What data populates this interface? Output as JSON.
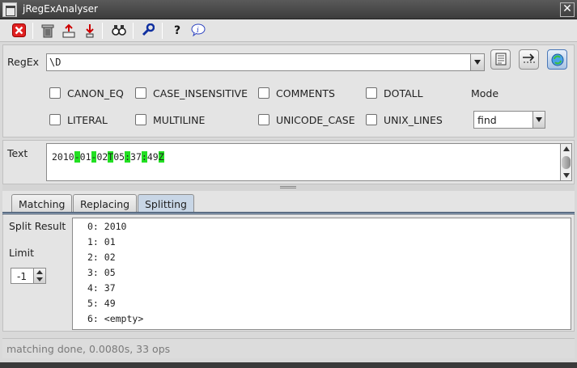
{
  "window": {
    "title": "jRegExAnalyser"
  },
  "toolbar": {
    "icons": [
      "close-red-x-icon",
      "trash-can-icon",
      "export-icon",
      "import-icon",
      "binoculars-icon",
      "wrench-icon",
      "help-question-icon",
      "info-icon"
    ]
  },
  "regex": {
    "label": "RegEx",
    "value": "\\D"
  },
  "flags": {
    "row1": [
      "CANON_EQ",
      "CASE_INSENSITIVE",
      "COMMENTS",
      "DOTALL"
    ],
    "row2": [
      "LITERAL",
      "MULTILINE",
      "UNICODE_CASE",
      "UNIX_LINES"
    ],
    "checked": []
  },
  "mode": {
    "label": "Mode",
    "value": "find"
  },
  "text": {
    "label": "Text",
    "segments": [
      {
        "t": "2010",
        "hl": false
      },
      {
        "t": "-",
        "hl": true
      },
      {
        "t": "01",
        "hl": false
      },
      {
        "t": "-",
        "hl": true
      },
      {
        "t": "02",
        "hl": false
      },
      {
        "t": "T",
        "hl": true
      },
      {
        "t": "05",
        "hl": false
      },
      {
        "t": ":",
        "hl": true
      },
      {
        "t": "37",
        "hl": false
      },
      {
        "t": ":",
        "hl": true
      },
      {
        "t": "49",
        "hl": false
      },
      {
        "t": "Z",
        "hl": true
      }
    ],
    "highlight_color": "#22e022"
  },
  "tabs": [
    {
      "label": "Matching",
      "active": false
    },
    {
      "label": "Replacing",
      "active": false
    },
    {
      "label": "Splitting",
      "active": true
    }
  ],
  "splitting": {
    "result_label": "Split Result",
    "limit_label": "Limit",
    "limit_value": "-1",
    "results": [
      {
        "index": "0:",
        "value": "2010"
      },
      {
        "index": "1:",
        "value": "01"
      },
      {
        "index": "2:",
        "value": "02"
      },
      {
        "index": "3:",
        "value": "05"
      },
      {
        "index": "4:",
        "value": "37"
      },
      {
        "index": "5:",
        "value": "49"
      },
      {
        "index": "6:",
        "value": "<empty>"
      }
    ]
  },
  "status": {
    "text": "matching done, 0.0080s, 33 ops"
  }
}
